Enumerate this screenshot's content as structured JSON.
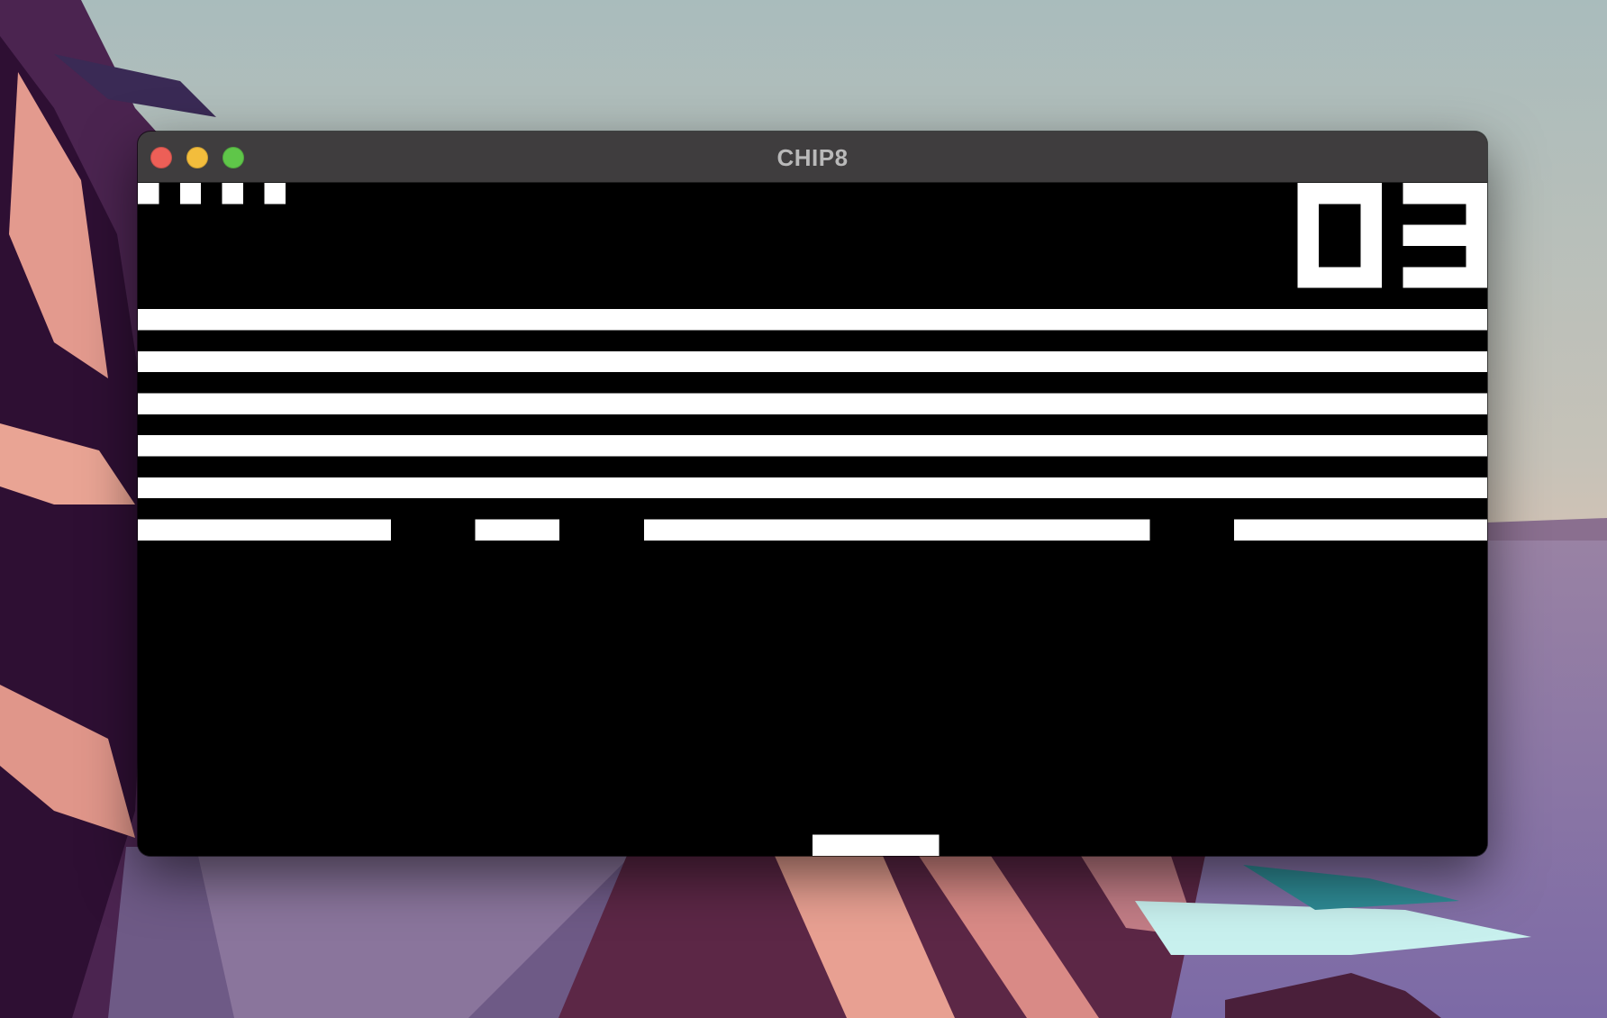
{
  "window": {
    "title": "CHIP8"
  },
  "game": {
    "name": "Breakout",
    "score": "03",
    "lives_remaining": 4,
    "brick_rows_full": 5,
    "brick_row_partial_bricks": 4,
    "colors": {
      "background": "#000000",
      "foreground": "#ffffff"
    }
  },
  "icons": {
    "close": "close-icon",
    "minimize": "minimize-icon",
    "maximize": "maximize-icon"
  }
}
